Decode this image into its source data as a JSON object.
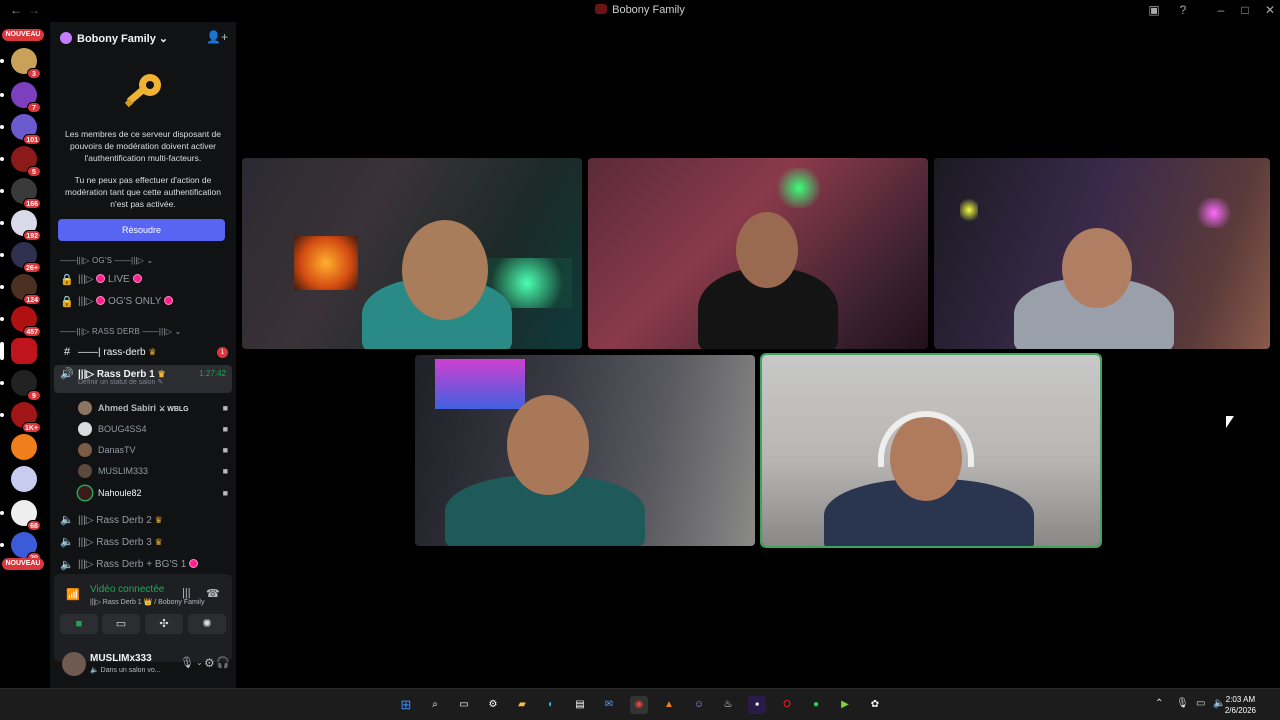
{
  "window": {
    "title": "Bobony Family",
    "back": "←",
    "forward": "→"
  },
  "rail": {
    "new_label_top": "NOUVEAU",
    "new_label_bottom": "NOUVEAU",
    "badges": [
      "3",
      "7",
      "101",
      "5",
      "166",
      "192",
      "26+",
      "124",
      "457",
      "9",
      "1K+",
      "68",
      "20"
    ]
  },
  "server": {
    "name": "Bobony Family",
    "chevron": "⌄",
    "invite_icon": "person-add-icon"
  },
  "mfa": {
    "line1": "Les membres de ce serveur disposant de pouvoirs de modération doivent activer l'authentification multi-facteurs.",
    "line2": "Tu ne peux pas effectuer d'action de modération tant que cette authentification n'est pas activée.",
    "button": "Résoudre"
  },
  "categories": {
    "ogs": "——|||▷ OG'S ——|||▷ ⌄",
    "rass": "——|||▷ RASS DERB ——|||▷ ⌄"
  },
  "channels": {
    "live": "|||▷",
    "live_name": "LIVE",
    "ogs_only": "|||▷",
    "ogs_only_name": "OG'S ONLY",
    "rass_derb_text": "——| rass-derb",
    "rass_derb_mentions": "1",
    "rd1": "|||▷ Rass Derb 1",
    "rd1_timer": "1:27:42",
    "rd1_status": "Définir un statut de salon ✎",
    "rd2": "|||▷ Rass Derb 2",
    "rd3": "|||▷ Rass Derb 3",
    "rd_bg": "|||▷ Rass Derb + BG'S 1"
  },
  "voice_users": [
    {
      "name": "Ahmed Sabiri",
      "tag": "⚔ WBLG"
    },
    {
      "name": "BOUG4SS4",
      "tag": ""
    },
    {
      "name": "DanasTV",
      "tag": ""
    },
    {
      "name": "MUSLIM333",
      "tag": ""
    },
    {
      "name": "Nahoule82",
      "tag": ""
    }
  ],
  "voice_panel": {
    "status": "Vidéo connectée",
    "sub": "|||▷ Rass Derb 1 👑 / Bobony Family"
  },
  "user": {
    "name": "MUSLIMx333",
    "status": "🔈 Dans un salon vo..."
  },
  "clock": {
    "time": "2:03 AM",
    "date": "2/6/2026"
  },
  "colors": {
    "accent": "#5865f2",
    "online": "#23a55a",
    "danger": "#da373c",
    "live_dot": "#ff1f8e"
  }
}
